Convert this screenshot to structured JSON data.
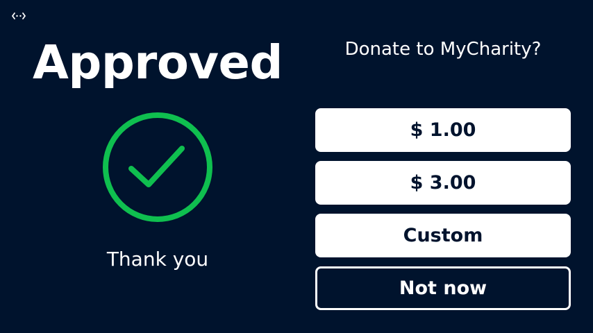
{
  "status": {
    "title": "Approved",
    "message": "Thank you",
    "accent_color": "#0fbf4f",
    "icon": "check-circle-icon"
  },
  "donation": {
    "prompt": "Donate to MyCharity?",
    "options": [
      {
        "label": "$ 1.00"
      },
      {
        "label": "$ 3.00"
      },
      {
        "label": "Custom"
      },
      {
        "label": "Not now"
      }
    ]
  },
  "theme": {
    "background": "#00132d",
    "button_background": "#ffffff",
    "button_text": "#00132d"
  },
  "corner_icon": "connection-icon"
}
